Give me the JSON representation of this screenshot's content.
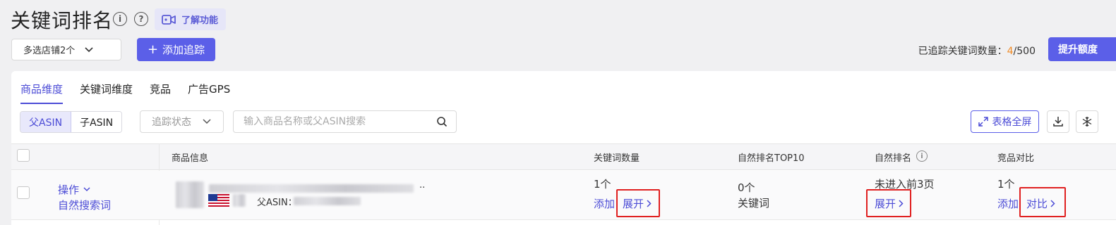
{
  "header": {
    "title": "关键词排名",
    "info_icon": "info-icon",
    "help_icon": "help-icon",
    "learn_label": "了解功能",
    "store_select": "多选店铺2个",
    "add_track_label": "添加追踪",
    "tracked_label": "已追踪关键词数量：",
    "tracked_current": "4",
    "tracked_total": "/500",
    "raise_label": "提升额度"
  },
  "tabs": [
    {
      "label": "商品维度",
      "active": true
    },
    {
      "label": "关键词维度",
      "active": false
    },
    {
      "label": "竞品",
      "active": false
    },
    {
      "label": "广告GPS",
      "active": false
    }
  ],
  "filters": {
    "asin_parent": "父ASIN",
    "asin_child": "子ASIN",
    "status_placeholder": "追踪状态",
    "search_placeholder": "输入商品名称或父ASIN搜索",
    "fullscreen_label": "表格全屏"
  },
  "table": {
    "headers": {
      "product": "商品信息",
      "keyword_count": "关键词数量",
      "top10": "自然排名TOP10",
      "natural_rank": "自然排名",
      "compare": "竞品对比"
    },
    "row": {
      "action": "操作",
      "natural_search": "自然搜索词",
      "title_suffix": "..",
      "parent_asin_label": "父ASIN：",
      "keyword_count": "1个",
      "add": "添加",
      "expand": "展开",
      "top10_count": "0个",
      "top10_unit": "关键词",
      "rank_text": "未进入前3页",
      "rank_expand": "展开",
      "compare_count": "1个",
      "compare_add": "添加",
      "compare_label": "对比"
    }
  },
  "colors": {
    "accent": "#5b5fe8",
    "highlight": "#f08a24",
    "annotation": "#e02020"
  }
}
